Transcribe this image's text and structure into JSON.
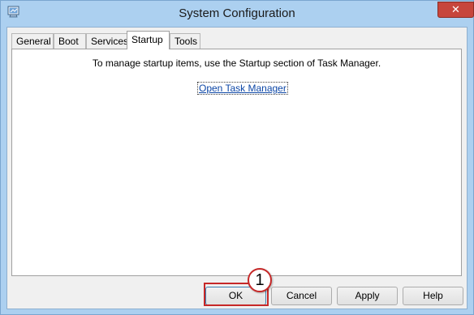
{
  "window": {
    "title": "System Configuration",
    "close_label": "✕",
    "tabs": [
      {
        "label": "General"
      },
      {
        "label": "Boot"
      },
      {
        "label": "Services"
      },
      {
        "label": "Startup",
        "selected": true
      },
      {
        "label": "Tools"
      }
    ]
  },
  "startup": {
    "message": "To manage startup items, use the Startup section of Task Manager.",
    "link_label": "Open Task Manager"
  },
  "buttons": {
    "ok": "OK",
    "cancel": "Cancel",
    "apply": "Apply",
    "help": "Help"
  },
  "annotation": {
    "step": "1",
    "color": "#c62828"
  }
}
